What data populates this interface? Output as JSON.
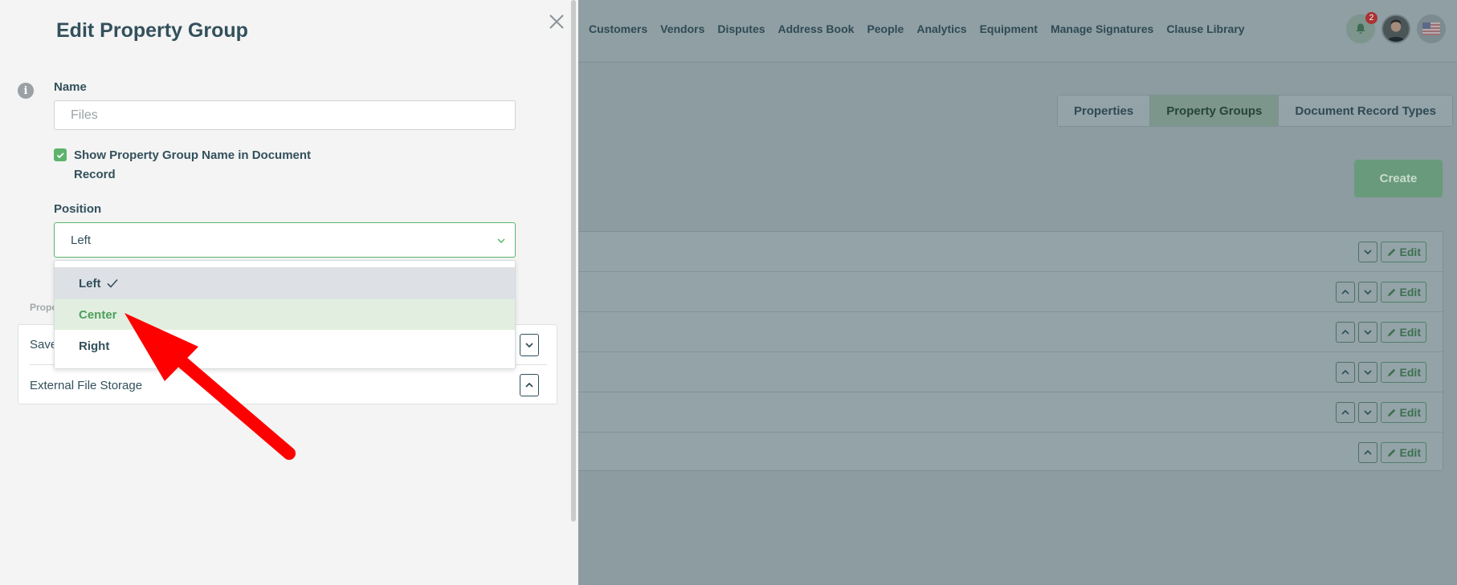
{
  "nav": {
    "items": [
      "Customers",
      "Vendors",
      "Disputes",
      "Address Book",
      "People",
      "Analytics",
      "Equipment",
      "Manage Signatures",
      "Clause Library"
    ]
  },
  "topbar": {
    "notification_count": "2"
  },
  "tabs": [
    {
      "label": "Properties",
      "active": false
    },
    {
      "label": "Property Groups",
      "active": true
    },
    {
      "label": "Document Record Types",
      "active": false
    }
  ],
  "create_label": "Create",
  "background_rows": {
    "edit_label": "Edit",
    "rows": 6
  },
  "panel": {
    "title": "Edit Property Group",
    "name_label": "Name",
    "name_value": "Files",
    "checkbox_label": "Show Property Group Name in Document Record",
    "checkbox_checked": true,
    "position_label": "Position",
    "position_value": "Left",
    "dropdown_options": [
      "Left",
      "Center",
      "Right"
    ],
    "properties_label": "Prope",
    "properties": [
      "Save",
      "External File Storage"
    ]
  },
  "colors": {
    "accent_green": "#5cb36b",
    "annotation_arrow": "#ff0000"
  }
}
